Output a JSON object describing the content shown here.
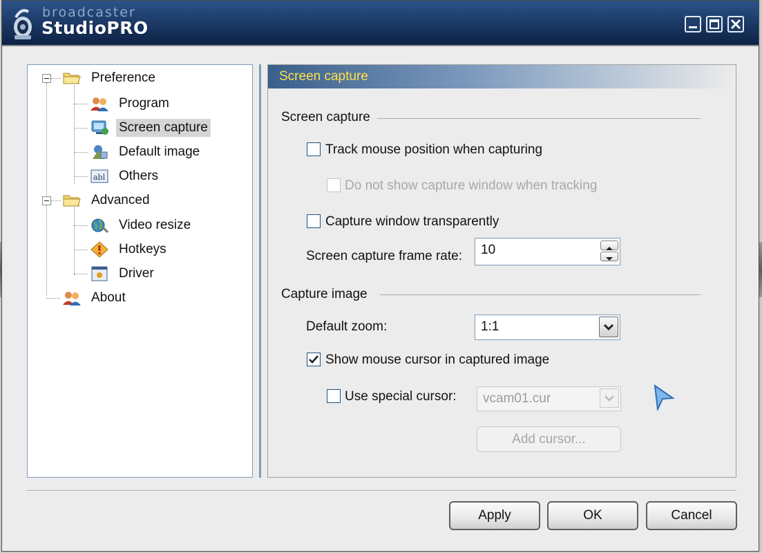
{
  "app": {
    "logo_small": "broadcaster",
    "logo_big": "StudioPRO"
  },
  "tree": [
    {
      "label": "Preference",
      "icon": "folder-icon",
      "level": 0,
      "expanded": true
    },
    {
      "label": "Program",
      "icon": "users-icon",
      "level": 1
    },
    {
      "label": "Screen capture",
      "icon": "monitor-icon",
      "level": 1,
      "selected": true
    },
    {
      "label": "Default image",
      "icon": "image-icon",
      "level": 1
    },
    {
      "label": "Others",
      "icon": "text-field-icon",
      "level": 1
    },
    {
      "label": "Advanced",
      "icon": "folder-icon",
      "level": 0,
      "expanded": true
    },
    {
      "label": "Video resize",
      "icon": "globe-icon",
      "level": 1
    },
    {
      "label": "Hotkeys",
      "icon": "warning-diamond-icon",
      "level": 1
    },
    {
      "label": "Driver",
      "icon": "driver-icon",
      "level": 1
    },
    {
      "label": "About",
      "icon": "users-icon",
      "level": 0
    }
  ],
  "panel": {
    "header": "Screen capture",
    "group_screen": "Screen capture",
    "track_mouse": {
      "label": "Track mouse position when capturing",
      "checked": false
    },
    "no_show_window": {
      "label": "Do not show capture window when tracking",
      "checked": false,
      "disabled": true
    },
    "capture_transparent": {
      "label": "Capture window transparently",
      "checked": false
    },
    "frame_rate_label": "Screen capture frame rate:",
    "frame_rate_value": "10",
    "group_image": "Capture image",
    "default_zoom_label": "Default zoom:",
    "default_zoom_value": "1:1",
    "show_cursor": {
      "label": "Show mouse cursor in captured image",
      "checked": true
    },
    "special_cursor": {
      "label": "Use special cursor:",
      "checked": false
    },
    "cursor_file": "vcam01.cur",
    "add_cursor": "Add cursor..."
  },
  "buttons": {
    "apply": "Apply",
    "ok": "OK",
    "cancel": "Cancel"
  },
  "colors": {
    "title_bar": "#1d3c6a",
    "header_text": "#ffe14a",
    "tree_border": "#7f9db9"
  }
}
